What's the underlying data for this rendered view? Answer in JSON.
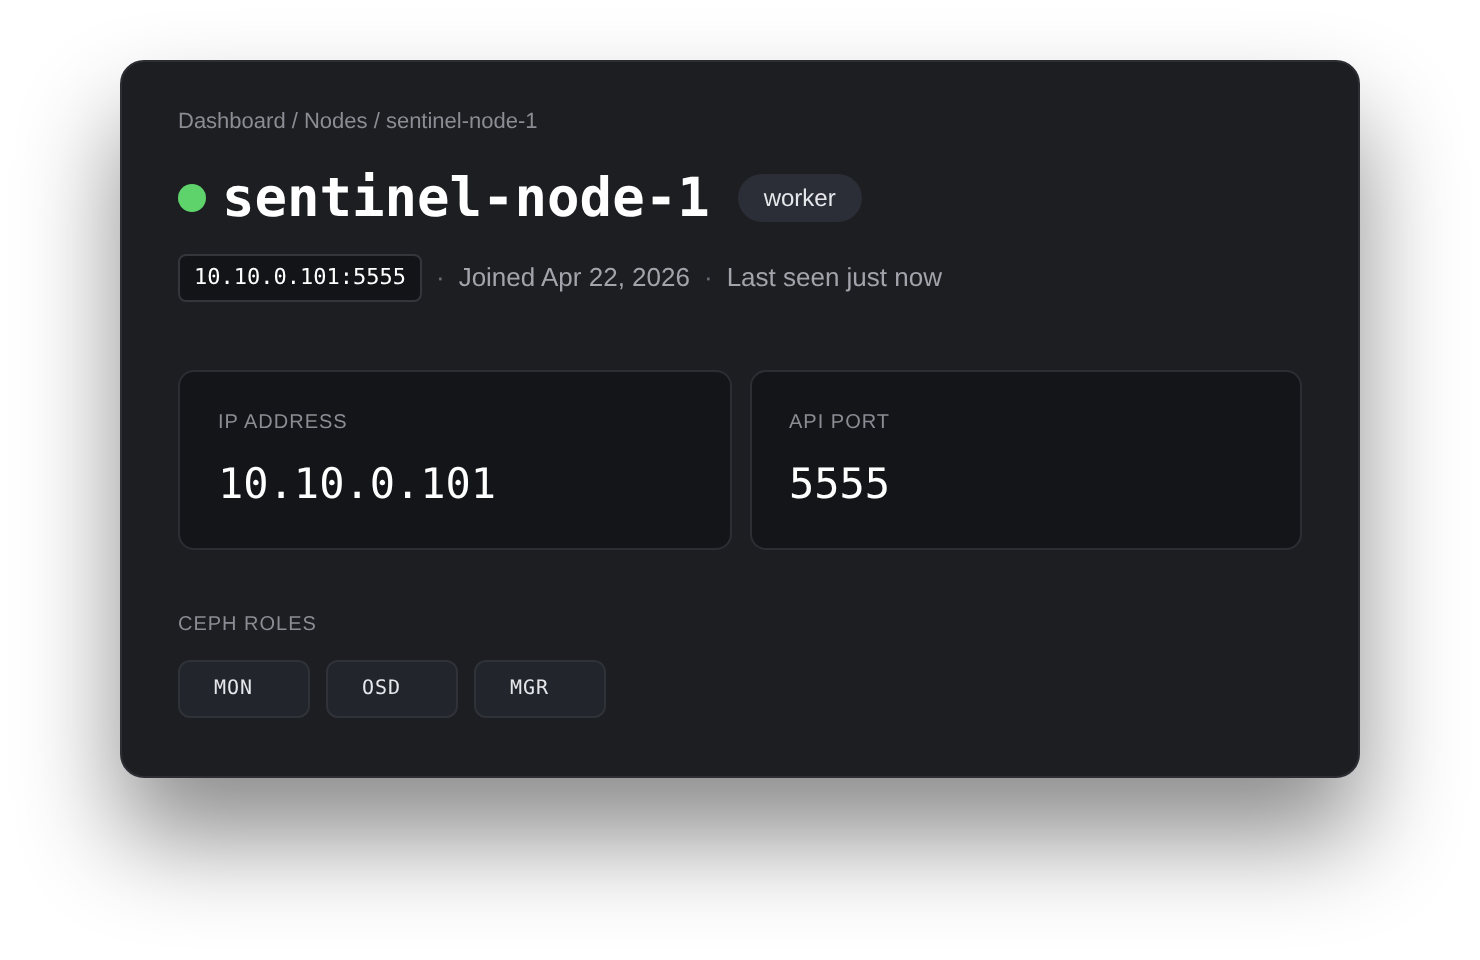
{
  "breadcrumb": "Dashboard / Nodes / sentinel-node-1",
  "node": {
    "name": "sentinel-node-1",
    "online": true,
    "role_badge": "worker"
  },
  "address_chip": "10.10.0.101:5555",
  "meta": [
    {
      "separator": "·",
      "text": "Joined Apr 22, 2026"
    },
    {
      "separator": "·",
      "text": "Last seen just now"
    }
  ],
  "stats": [
    {
      "label": "IP ADDRESS",
      "value": "10.10.0.101"
    },
    {
      "label": "API PORT",
      "value": "5555"
    }
  ],
  "ceph_roles": {
    "label": "CEPH ROLES",
    "items": [
      "MON",
      "OSD",
      "MGR"
    ]
  }
}
